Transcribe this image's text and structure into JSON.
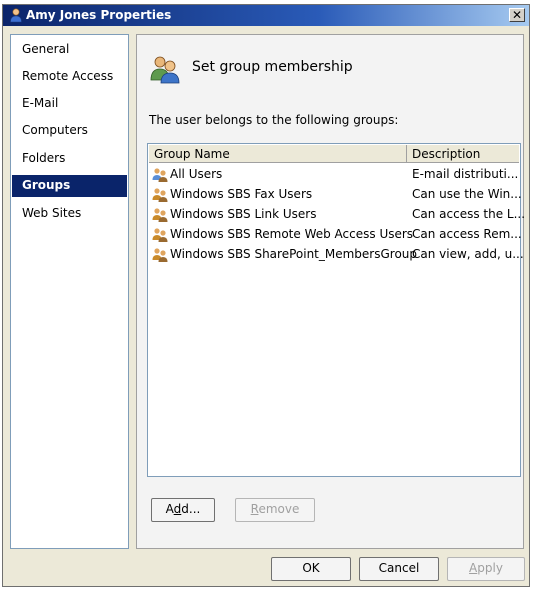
{
  "window": {
    "title": "Amy Jones Properties",
    "close_label": "✕"
  },
  "sidebar": {
    "items": [
      {
        "label": "General",
        "selected": false
      },
      {
        "label": "Remote Access",
        "selected": false
      },
      {
        "label": "E-Mail",
        "selected": false
      },
      {
        "label": "Computers",
        "selected": false
      },
      {
        "label": "Folders",
        "selected": false
      },
      {
        "label": "Groups",
        "selected": true
      },
      {
        "label": "Web Sites",
        "selected": false
      }
    ]
  },
  "main": {
    "title": "Set group membership",
    "subtext": "The user belongs to the following groups:",
    "list": {
      "columns": [
        "Group Name",
        "Description"
      ],
      "rows": [
        {
          "name": "All Users",
          "description": "E-mail distributi...",
          "icon": "group-icon"
        },
        {
          "name": "Windows SBS Fax Users",
          "description": "Can use the Win...",
          "icon": "group-icon"
        },
        {
          "name": "Windows SBS Link Users",
          "description": "Can access the L...",
          "icon": "group-icon"
        },
        {
          "name": "Windows SBS Remote Web Access Users",
          "description": "Can access Rem...",
          "icon": "group-icon"
        },
        {
          "name": "Windows SBS SharePoint_MembersGroup",
          "description": "Can view, add, u...",
          "icon": "group-icon"
        }
      ]
    },
    "add_label_pre": "A",
    "add_label_u": "d",
    "add_label_post": "d...",
    "remove_label_u": "R",
    "remove_label_post": "emove"
  },
  "footer": {
    "ok_label": "OK",
    "cancel_label": "Cancel",
    "apply_label_u": "A",
    "apply_label_post": "pply"
  },
  "colors": {
    "title_bar": "#0b246a",
    "selected_nav": "#0a246a",
    "dialog_bg": "#ece9d8"
  }
}
